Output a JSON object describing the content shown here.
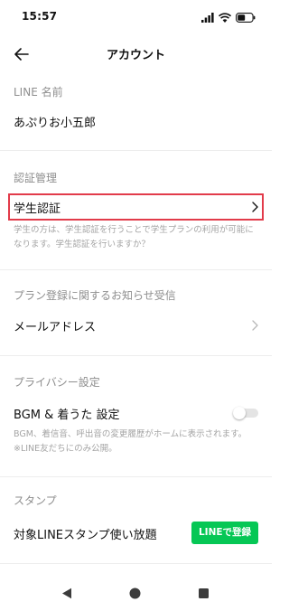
{
  "status_bar": {
    "time": "15:57"
  },
  "header": {
    "title": "アカウント"
  },
  "sections": {
    "line_name": {
      "header": "LINE 名前",
      "value": "あぷりお小五郎"
    },
    "auth": {
      "header": "認証管理",
      "student_label": "学生認証",
      "student_desc": "学生の方は、学生認証を行うことで学生プランの利用が可能になります。学生認証を行いますか？"
    },
    "plan": {
      "header": "プラン登録に関するお知らせ受信",
      "email_label": "メールアドレス"
    },
    "privacy": {
      "header": "プライバシー設定",
      "bgm_label": "BGM & 着うた 設定",
      "bgm_desc_1": "BGM、着信音、呼出音の変更履歴がホームに表示されます。",
      "bgm_desc_2": "※LINE友だちにのみ公開。",
      "bgm_toggle_on": false
    },
    "stamp": {
      "header": "スタンプ",
      "unlimited_label": "対象LINEスタンプ使い放題",
      "register_button": "LINEで登録"
    }
  },
  "colors": {
    "accent": "#06c755",
    "highlight": "#e23b4a",
    "muted": "#8e8e8e"
  },
  "icons": [
    "back-arrow-icon",
    "chevron-right-icon",
    "signal-icon",
    "wifi-icon",
    "battery-icon",
    "back-triangle-icon",
    "home-circle-icon",
    "recents-square-icon"
  ]
}
